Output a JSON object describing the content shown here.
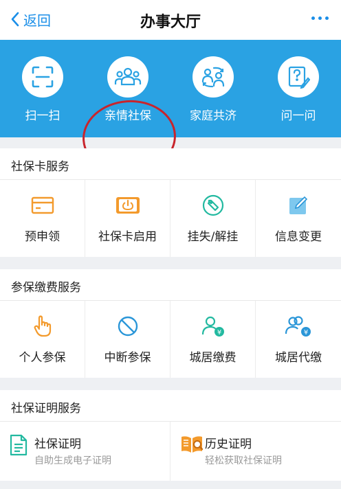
{
  "nav": {
    "back_label": "返回",
    "title": "办事大厅"
  },
  "banner": {
    "items": [
      {
        "label": "扫一扫",
        "icon": "scan-icon"
      },
      {
        "label": "亲情社保",
        "icon": "family-group-icon"
      },
      {
        "label": "家庭共济",
        "icon": "family-share-icon"
      },
      {
        "label": "问一问",
        "icon": "question-icon"
      }
    ]
  },
  "card_service": {
    "title": "社保卡服务",
    "items": [
      {
        "label": "预申领",
        "icon": "card-icon"
      },
      {
        "label": "社保卡启用",
        "icon": "card-power-icon"
      },
      {
        "label": "挂失/解挂",
        "icon": "tag-icon"
      },
      {
        "label": "信息变更",
        "icon": "edit-icon"
      }
    ]
  },
  "pay_service": {
    "title": "参保缴费服务",
    "items": [
      {
        "label": "个人参保",
        "icon": "hand-pointer-icon"
      },
      {
        "label": "中断参保",
        "icon": "stop-icon"
      },
      {
        "label": "城居缴费",
        "icon": "user-yen-icon"
      },
      {
        "label": "城居代缴",
        "icon": "users-yen-icon"
      }
    ]
  },
  "proof_service": {
    "title": "社保证明服务",
    "items": [
      {
        "label": "社保证明",
        "desc": "自助生成电子证明",
        "icon": "document-icon"
      },
      {
        "label": "历史证明",
        "desc": "轻松获取社保证明",
        "icon": "book-search-icon"
      }
    ]
  },
  "colors": {
    "accent": "#1a8ee8",
    "banner": "#2aa2e3",
    "orange": "#f39a2c",
    "teal": "#22b9a0",
    "highlight": "#c8242c"
  }
}
